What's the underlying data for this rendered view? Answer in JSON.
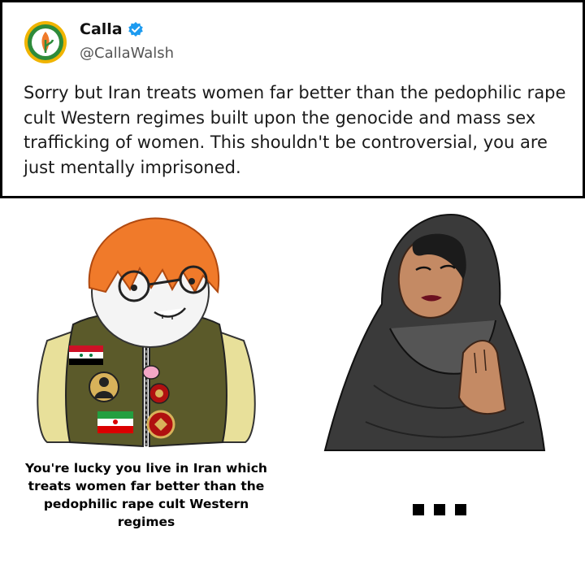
{
  "tweet": {
    "display_name": "Calla",
    "handle": "@CallaWalsh",
    "verified_icon": "verified-check-icon",
    "text": "Sorry but Iran treats women far better than the pedophilic rape cult Western regimes built upon the genocide and mass sex trafficking of women. This shouldn't be controversial, you are just mentally imprisoned."
  },
  "meme": {
    "left_caption": "You're lucky you live in Iran which treats women far better than the pedophilic rape cult Western regimes",
    "right_caption": "..."
  },
  "colors": {
    "verified_blue": "#1d9bf0",
    "avatar_green": "#2e8b3a",
    "avatar_ring": "#f0b400",
    "hair_orange": "#f07a2a",
    "vest_olive": "#5b5a2a",
    "sleeve_yellow": "#e8e09a"
  }
}
